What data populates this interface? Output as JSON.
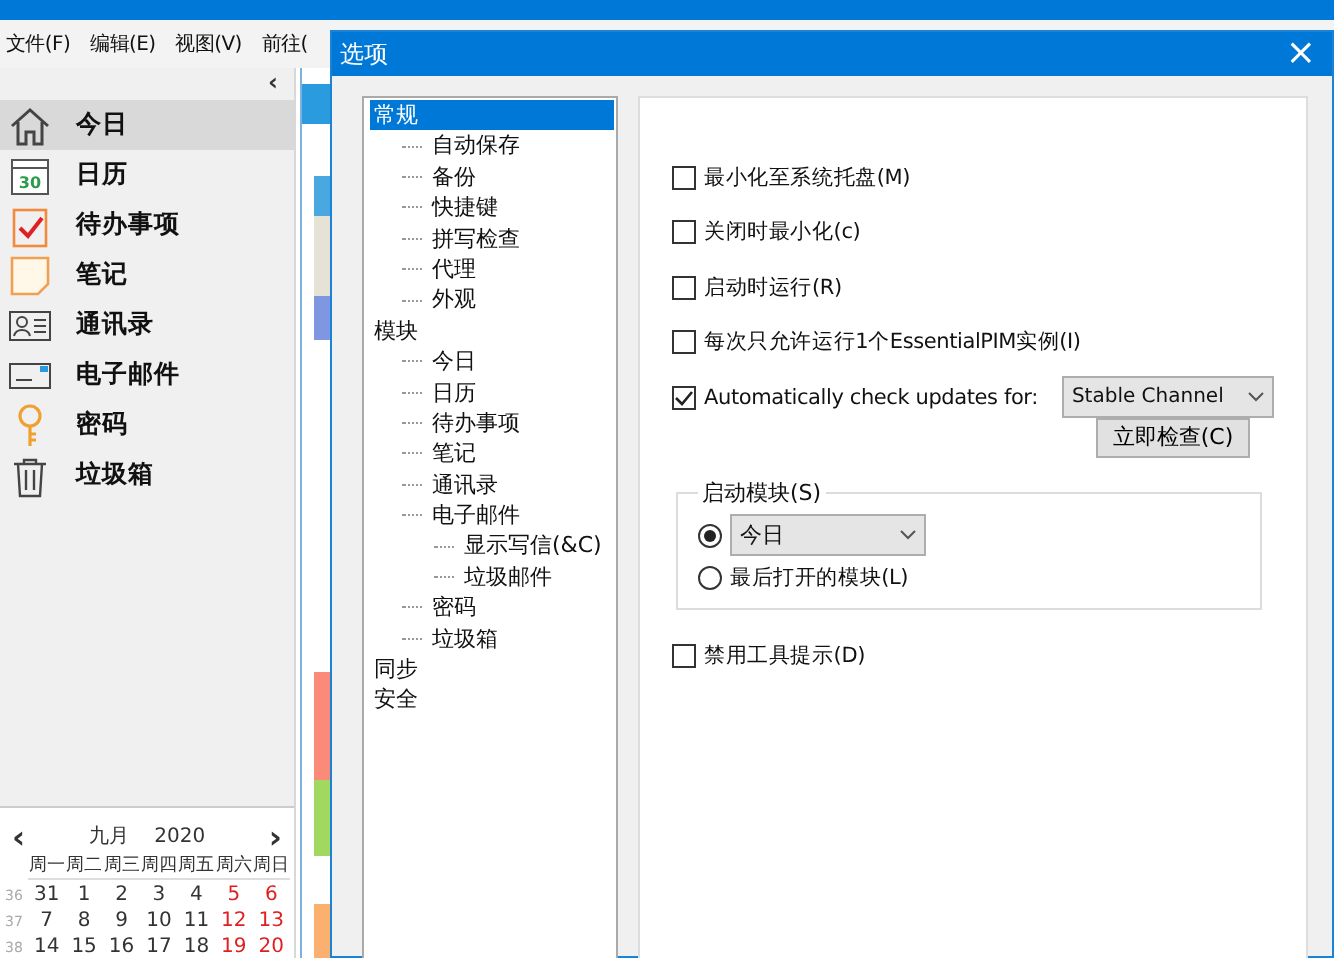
{
  "app": {
    "collapse": "‹",
    "menu": [
      "文件(F)",
      "编辑(E)",
      "视图(V)",
      "前往("
    ],
    "nav": [
      {
        "kind": "home",
        "label": "今日",
        "selected": true
      },
      {
        "kind": "calendar",
        "label": "日历",
        "selected": false,
        "icon_text": "30"
      },
      {
        "kind": "todo",
        "label": "待办事项",
        "selected": false
      },
      {
        "kind": "note",
        "label": "笔记",
        "selected": false
      },
      {
        "kind": "contacts",
        "label": "通讯录",
        "selected": false
      },
      {
        "kind": "mail",
        "label": "电子邮件",
        "selected": false
      },
      {
        "kind": "key",
        "label": "密码",
        "selected": false
      },
      {
        "kind": "trash",
        "label": "垃圾箱",
        "selected": false
      }
    ],
    "calendar": {
      "month": "九月",
      "year": "2020",
      "prev": "‹",
      "next": "›",
      "weekdays": [
        "周一",
        "周二",
        "周三",
        "周四",
        "周五",
        "周六",
        "周日"
      ],
      "weeks": [
        {
          "number": "36",
          "days": [
            "31",
            "1",
            "2",
            "3",
            "4",
            "5",
            "6"
          ]
        },
        {
          "number": "37",
          "days": [
            "7",
            "8",
            "9",
            "10",
            "11",
            "12",
            "13"
          ]
        },
        {
          "number": "38",
          "days": [
            "14",
            "15",
            "16",
            "17",
            "18",
            "19",
            "20"
          ]
        }
      ]
    },
    "strip": [
      {
        "color": "#4aa8e0"
      },
      {
        "color": "#e6e3d6"
      },
      {
        "color": "#7f97e0"
      },
      {
        "color": "#fb8a78"
      },
      {
        "color": "#a0d860"
      },
      {
        "color": "#fbb070"
      }
    ]
  },
  "dialog": {
    "title": "选项",
    "close": "×",
    "tree": [
      {
        "label": "常规",
        "selected": true,
        "children": [
          {
            "label": "自动保存",
            "selected": false
          },
          {
            "label": "备份",
            "selected": false
          },
          {
            "label": "快捷键",
            "selected": false
          },
          {
            "label": "拼写检查",
            "selected": false
          },
          {
            "label": "代理",
            "selected": false
          },
          {
            "label": "外观",
            "selected": false
          }
        ]
      },
      {
        "label": "模块",
        "selected": false,
        "children": [
          {
            "label": "今日",
            "selected": false
          },
          {
            "label": "日历",
            "selected": false
          },
          {
            "label": "待办事项",
            "selected": false
          },
          {
            "label": "笔记",
            "selected": false
          },
          {
            "label": "通讯录",
            "selected": false
          },
          {
            "label": "电子邮件",
            "selected": false,
            "children": [
              {
                "label": "显示写信(&C)",
                "selected": false
              },
              {
                "label": "垃圾邮件",
                "selected": false
              }
            ]
          },
          {
            "label": "密码",
            "selected": false
          },
          {
            "label": "垃圾箱",
            "selected": false
          }
        ]
      },
      {
        "label": "同步",
        "selected": false
      },
      {
        "label": "安全",
        "selected": false
      }
    ],
    "options": [
      {
        "label": "最小化至系统托盘(M)",
        "checked": false
      },
      {
        "label": "关闭时最小化(c)",
        "checked": false
      },
      {
        "label": "启动时运行(R)",
        "checked": false
      },
      {
        "label": "每次只允许运行1个EssentialPIM实例(I)",
        "checked": false
      },
      {
        "label": "Automatically check updates for:",
        "checked": true
      }
    ],
    "update_channel": "Stable Channel",
    "check_now": "立即检查(C)",
    "startup": {
      "title": "启动模块(S)",
      "choices": [
        {
          "kind": "dropdown",
          "value": "今日",
          "selected": true
        },
        {
          "kind": "label",
          "label": "最后打开的模块(L)",
          "selected": false
        }
      ]
    },
    "disable_tooltips": {
      "label": "禁用工具提示(D)",
      "checked": false
    }
  }
}
